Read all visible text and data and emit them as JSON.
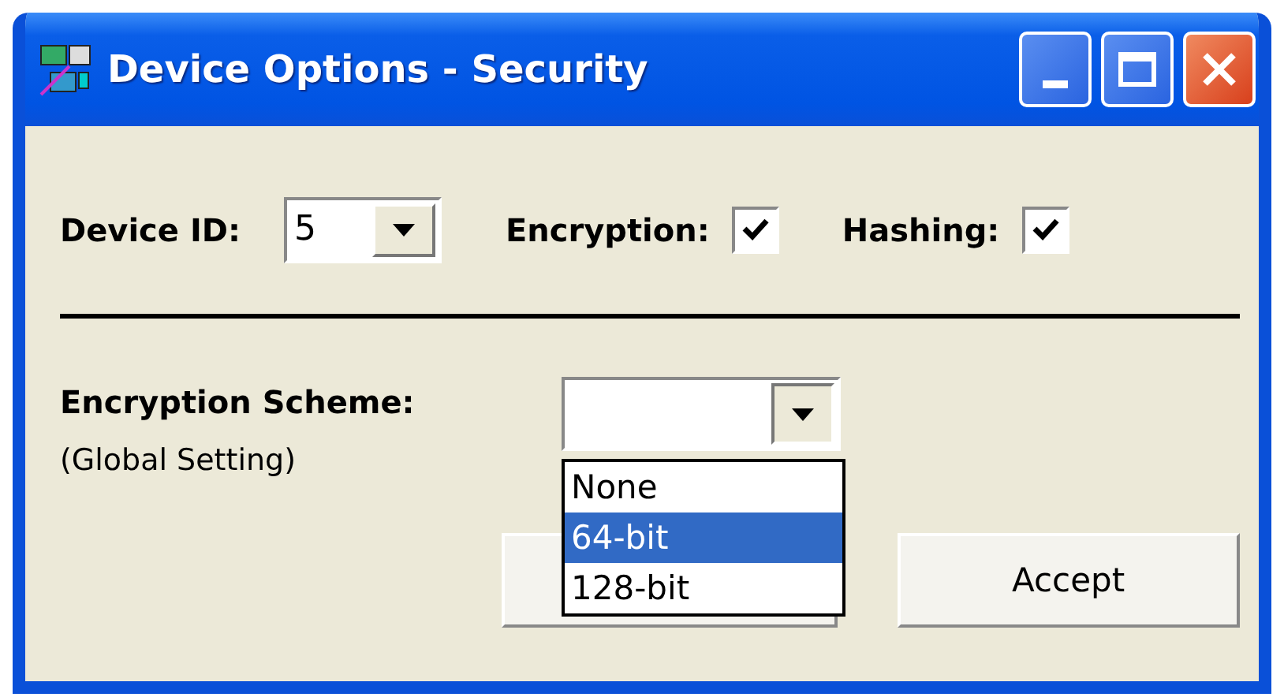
{
  "window": {
    "title": "Device Options - Security"
  },
  "device_id": {
    "label": "Device ID:",
    "value": "5"
  },
  "encryption": {
    "label": "Encryption:",
    "checked": true
  },
  "hashing": {
    "label": "Hashing:",
    "checked": true
  },
  "encryption_scheme": {
    "label": "Encryption Scheme:",
    "note": "(Global Setting)",
    "expanded": true,
    "options": [
      {
        "label": "None",
        "selected": false
      },
      {
        "label": "64-bit",
        "selected": true
      },
      {
        "label": "128-bit",
        "selected": false
      }
    ]
  },
  "buttons": [
    {
      "label": "Accept"
    }
  ]
}
